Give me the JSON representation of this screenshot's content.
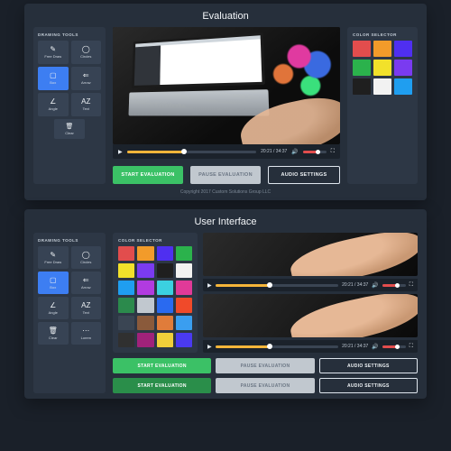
{
  "panel1_title": "Evaluation",
  "panel2_title": "User Interface",
  "tools_label": "DRAWING TOOLS",
  "tools": [
    {
      "key": "freedraw",
      "label": "Free Draw",
      "icon": "✎"
    },
    {
      "key": "circles",
      "label": "Circles",
      "icon": "◯"
    },
    {
      "key": "box",
      "label": "Box",
      "icon": "▢",
      "active": true
    },
    {
      "key": "arrow",
      "label": "Arrow",
      "icon": "⇐"
    },
    {
      "key": "angle",
      "label": "Angle",
      "icon": "∠"
    },
    {
      "key": "text",
      "label": "Text",
      "icon": "AZ"
    }
  ],
  "clear": {
    "label": "Clear",
    "icon": "🗑"
  },
  "tools_bottom_extra": [
    {
      "key": "clear",
      "label": "Clear",
      "icon": "🗑"
    },
    {
      "key": "lorem",
      "label": "Lorem",
      "icon": "⋯"
    }
  ],
  "player": {
    "time_current": "20:21",
    "time_total": "34:37"
  },
  "buttons": {
    "start": "START EVALUATION",
    "pause": "PAUSE EVALUATION",
    "audio": "AUDIO SETTINGS"
  },
  "color_selector_label": "COLOR SELECTOR",
  "colors_top": [
    "#e24d4d",
    "#f29b2a",
    "#4f2ff0",
    "#2bb24c",
    "#f2e12a",
    "#7a3bf0",
    "#1f1f1f",
    "#f2f2f2",
    "#1f9ef0"
  ],
  "colors_big": [
    "#e24d4d",
    "#f29b2a",
    "#4f2ff0",
    "#2bb24c",
    "#f2e12a",
    "#7a3bf0",
    "#1f1f1f",
    "#f2f2f2",
    "#1f9ef0",
    "#b13be0",
    "#3bd1e0",
    "#e03a98",
    "#2b8a4c",
    "#c1c8cf",
    "#2a6af0",
    "#f04a2a",
    "#3a4553",
    "#8a5a3b",
    "#e07c3a",
    "#3a9ef0",
    "#303030",
    "#a0227a",
    "#f0cf3a",
    "#4a3af0"
  ],
  "copyright": "Copyright 2017 Custom Solutions Group LLC"
}
